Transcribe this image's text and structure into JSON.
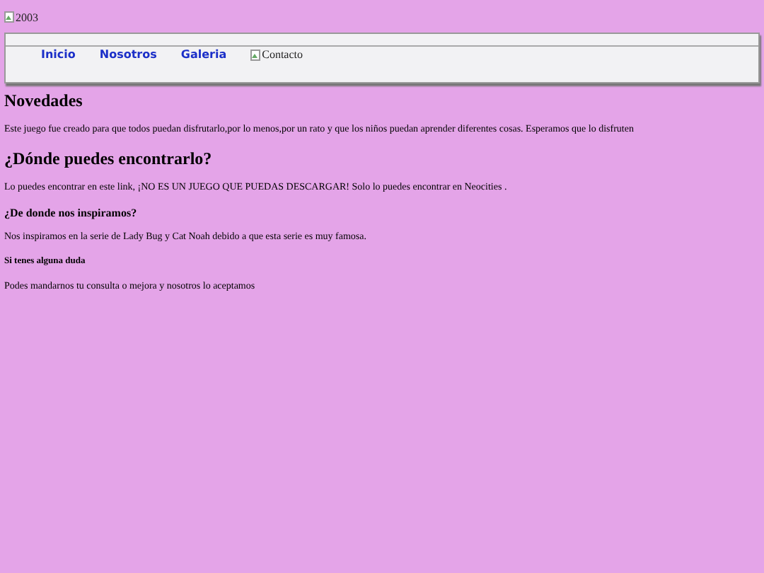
{
  "banner_image": {
    "alt": "2003"
  },
  "nav": [
    {
      "kind": "link",
      "label": "Inicio"
    },
    {
      "kind": "link",
      "label": "Nosotros"
    },
    {
      "kind": "link",
      "label": "Galeria"
    },
    {
      "kind": "image",
      "label": "Contacto"
    }
  ],
  "sections": [
    {
      "kind": "h2",
      "heading": "Novedades",
      "text": "Este juego fue creado para que todos puedan disfrutarlo,por lo menos,por un rato y que los niños puedan aprender diferentes cosas. Esperamos que lo disfruten"
    },
    {
      "kind": "h2",
      "heading": "¿Dónde puedes encontrarlo?",
      "text": "Lo puedes encontrar en este link, ¡NO ES UN JUEGO QUE PUEDAS DESCARGAR! Solo lo puedes encontrar en Neocities ."
    },
    {
      "kind": "h4",
      "heading": "¿De donde nos inspiramos?",
      "text": "Nos inspiramos en la serie de Lady Bug y Cat Noah debido a que esta serie es muy famosa."
    },
    {
      "kind": "h5",
      "heading": "Si tenes alguna duda",
      "text": "Podes mandarnos tu consulta o mejora y nosotros lo aceptamos"
    }
  ]
}
